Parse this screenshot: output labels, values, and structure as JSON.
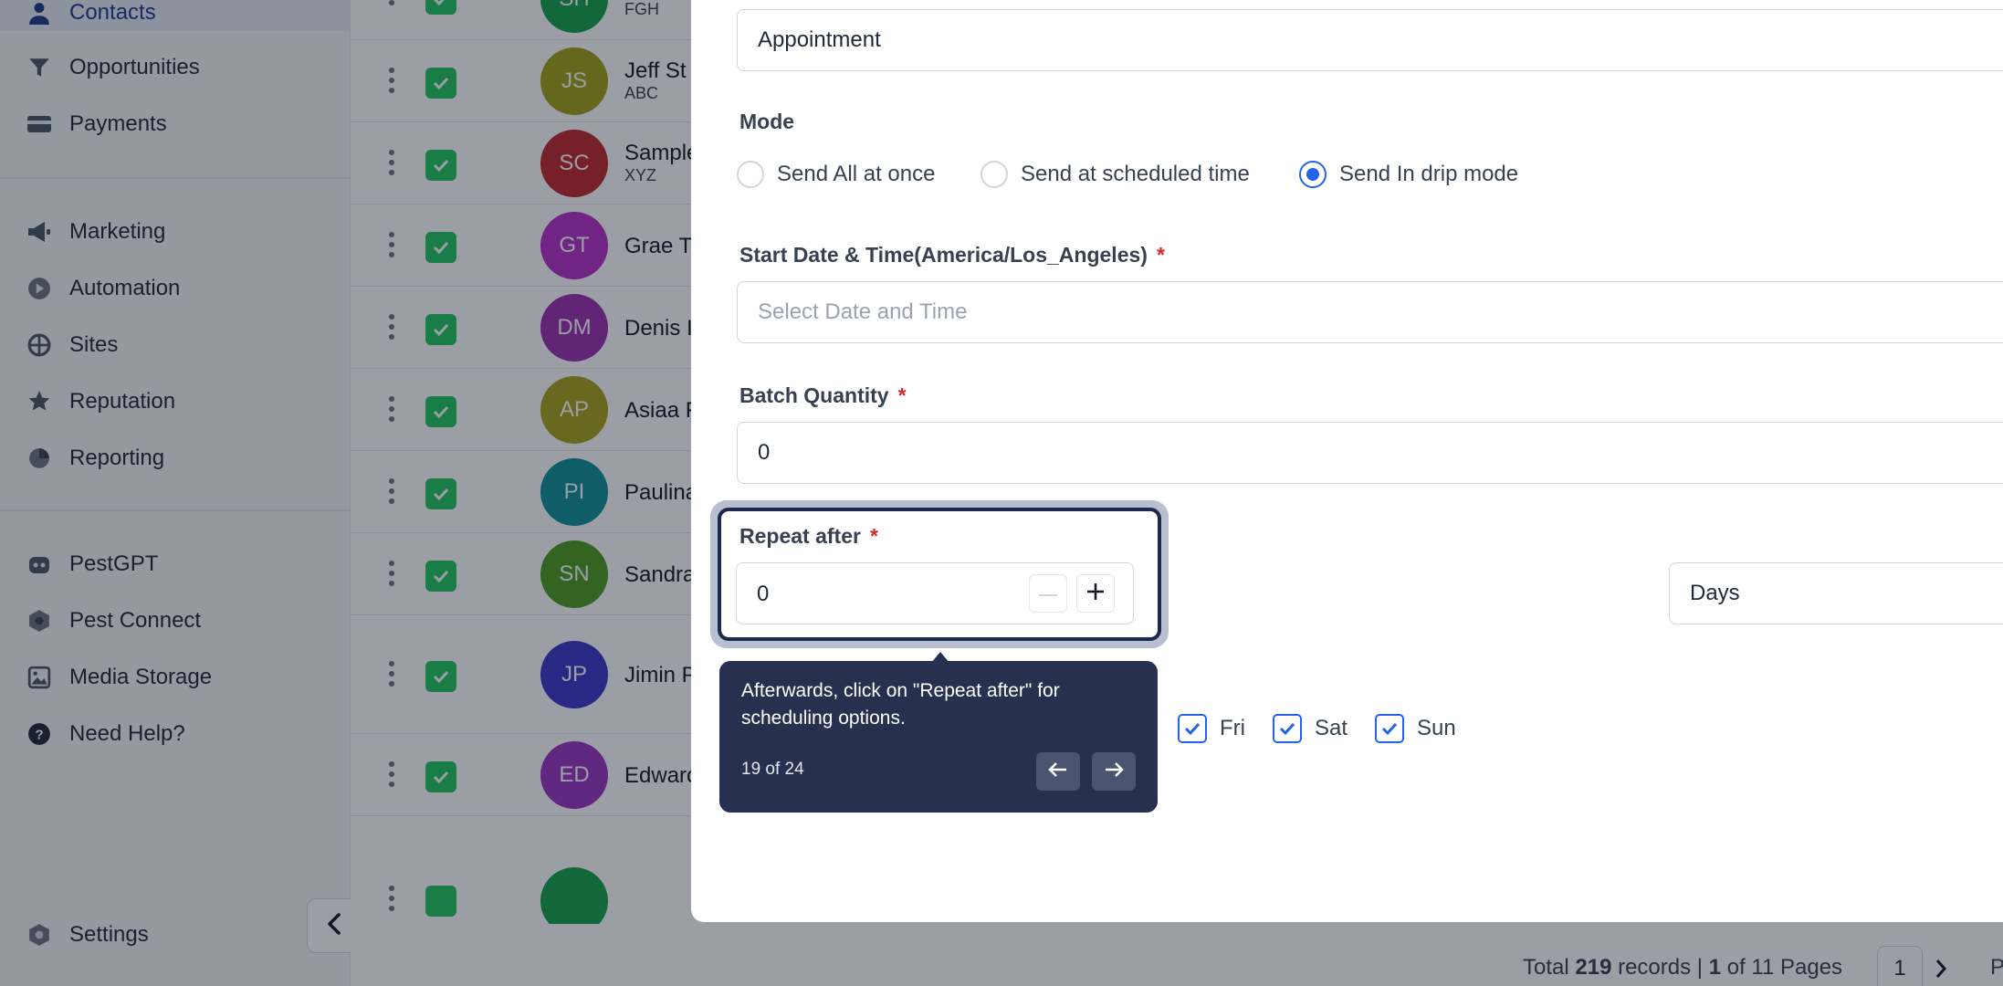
{
  "sidebar": {
    "items": [
      {
        "label": "Contacts",
        "icon": "user-icon"
      },
      {
        "label": "Opportunities",
        "icon": "filter-icon"
      },
      {
        "label": "Payments",
        "icon": "card-icon"
      },
      {
        "label": "Marketing",
        "icon": "megaphone-icon"
      },
      {
        "label": "Automation",
        "icon": "automation-icon"
      },
      {
        "label": "Sites",
        "icon": "globe-icon"
      },
      {
        "label": "Reputation",
        "icon": "star-icon"
      },
      {
        "label": "Reporting",
        "icon": "pie-chart-icon"
      },
      {
        "label": "PestGPT",
        "icon": "bot-icon"
      },
      {
        "label": "Pest Connect",
        "icon": "hexagon-icon"
      },
      {
        "label": "Media Storage",
        "icon": "image-icon"
      },
      {
        "label": "Need Help?",
        "icon": "question-icon"
      },
      {
        "label": "Settings",
        "icon": "gear-icon"
      }
    ]
  },
  "contacts": [
    {
      "initials": "SH",
      "name": "",
      "sub": "FGH",
      "color": "#16a34a"
    },
    {
      "initials": "JS",
      "name": "Jeff St",
      "sub": "ABC",
      "color": "#a3a316"
    },
    {
      "initials": "SC",
      "name": "Sample",
      "sub": "XYZ",
      "color": "#c0262d"
    },
    {
      "initials": "GT",
      "name": "Grae T",
      "sub": "",
      "color": "#b62fc9"
    },
    {
      "initials": "DM",
      "name": "Denis I",
      "sub": "",
      "color": "#9b2fb0"
    },
    {
      "initials": "AP",
      "name": "Asiaa F",
      "sub": "",
      "color": "#a7a31a"
    },
    {
      "initials": "PI",
      "name": "Paulina",
      "sub": "",
      "color": "#0e8f96"
    },
    {
      "initials": "SN",
      "name": "Sandra",
      "sub": "",
      "color": "#4d9c1f"
    },
    {
      "initials": "JP",
      "name": "Jimin P",
      "sub": "",
      "color": "#3c35c9"
    },
    {
      "initials": "ED",
      "name": "Edwarc",
      "sub": "",
      "color": "#9a34c2"
    }
  ],
  "form": {
    "type_value": "Appointment",
    "mode_label": "Mode",
    "mode_options": [
      "Send All at once",
      "Send at scheduled time",
      "Send In drip mode"
    ],
    "mode_selected": "Send In drip mode",
    "start_label": "Start Date & Time(America/Los_Angeles)",
    "start_placeholder": "Select Date and Time",
    "batch_label": "Batch Quantity",
    "batch_value": "0",
    "repeat_label": "Repeat after",
    "repeat_value": "0",
    "unit_value": "Days",
    "required_mark": "*",
    "days": [
      {
        "label": "Fri",
        "checked": true
      },
      {
        "label": "Sat",
        "checked": true
      },
      {
        "label": "Sun",
        "checked": true
      }
    ]
  },
  "tooltip": {
    "text": "Afterwards, click on \"Repeat after\" for scheduling options.",
    "counter": "19 of 24"
  },
  "footer": {
    "total_prefix": "Total",
    "total_count": "219",
    "total_suffix": "records |",
    "page_current": "1",
    "page_of": "of 11 Pages",
    "page_box": "1",
    "page_trailing": "P"
  },
  "colors": {
    "accent": "#2563eb",
    "tooltip_bg": "#27314f",
    "required": "#dc2626",
    "check_green": "#22c55e"
  }
}
